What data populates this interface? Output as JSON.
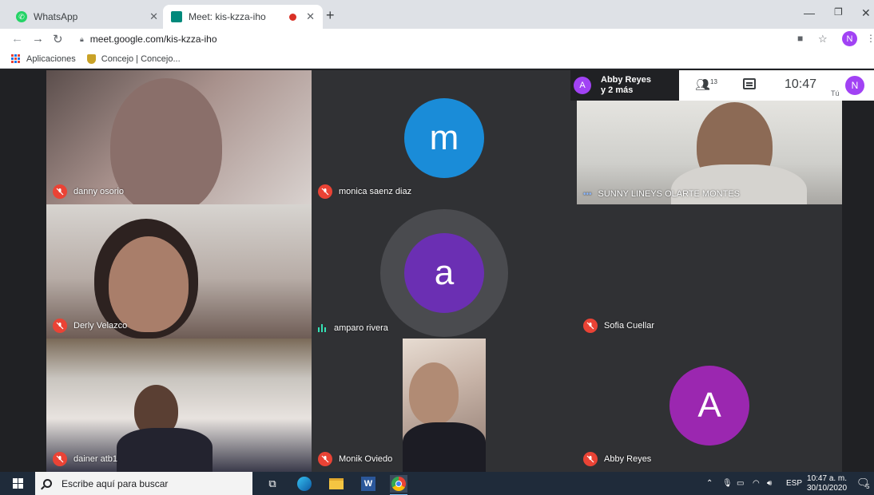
{
  "browser": {
    "tabs": [
      {
        "title": "WhatsApp",
        "active": false
      },
      {
        "title": "Meet: kis-kzza-iho",
        "active": true
      }
    ],
    "url": "meet.google.com/kis-kzza-iho",
    "profile_initial": "N",
    "bookmarks": [
      {
        "label": "Aplicaciones"
      },
      {
        "label": "Concejo | Concejo..."
      }
    ]
  },
  "meet": {
    "presenter": {
      "initial": "A",
      "line1": "Abby Reyes",
      "line2": "y 2 más"
    },
    "people_count": "13",
    "clock": "10:47",
    "you_label": "Tú",
    "you_initial": "N",
    "tiles": [
      {
        "name": "danny osorio",
        "muted": true
      },
      {
        "name": "monica saenz diaz",
        "muted": true,
        "initial": "m"
      },
      {
        "name": "SUNNY LINEYS OLARTE MONTES",
        "muted": false
      },
      {
        "name": "Derly Velazco",
        "muted": true
      },
      {
        "name": "amparo rivera",
        "muted": false,
        "initial": "a"
      },
      {
        "name": "Sofia Cuellar",
        "muted": true
      },
      {
        "name": "dainer atb1",
        "muted": true
      },
      {
        "name": "Monik Oviedo",
        "muted": true
      },
      {
        "name": "Abby Reyes",
        "muted": true,
        "initial": "A"
      }
    ],
    "colors": {
      "blue_avatar": "#1a8cd8",
      "purple_avatar": "#6b2fb3",
      "purple_avatar_2": "#9b27b0",
      "mute_red": "#ea4335"
    }
  },
  "taskbar": {
    "search_placeholder": "Escribe aquí para buscar",
    "language": "ESP",
    "time": "10:47 a. m.",
    "date": "30/10/2020",
    "notification_count": "5"
  }
}
